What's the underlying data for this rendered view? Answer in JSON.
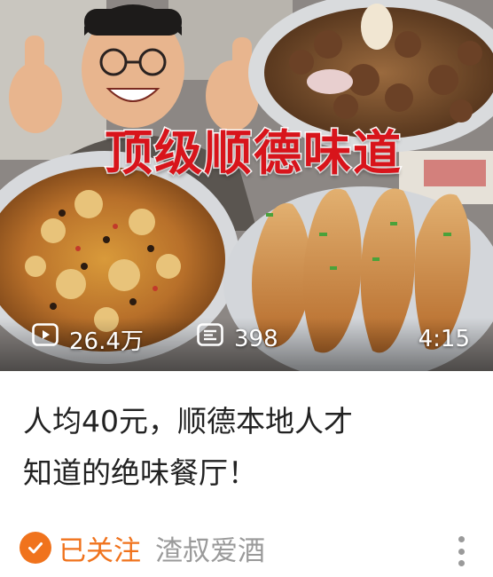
{
  "video": {
    "banner_text": "顶级顺德味道",
    "play_count": "26.4万",
    "danmaku_count": "398",
    "duration": "4:15"
  },
  "title": {
    "line1": "人均40元，顺德本地人才",
    "line2": "知道的绝味餐厅！"
  },
  "footer": {
    "follow_label": "已关注",
    "author_name": "渣叔爱酒"
  },
  "colors": {
    "accent": "#f0731d",
    "banner_red": "#d8141b",
    "title_text": "#222222",
    "secondary_text": "#9a9a9a"
  },
  "icons": [
    "play-count-icon",
    "danmaku-icon",
    "follow-check-icon",
    "more-options-icon"
  ]
}
